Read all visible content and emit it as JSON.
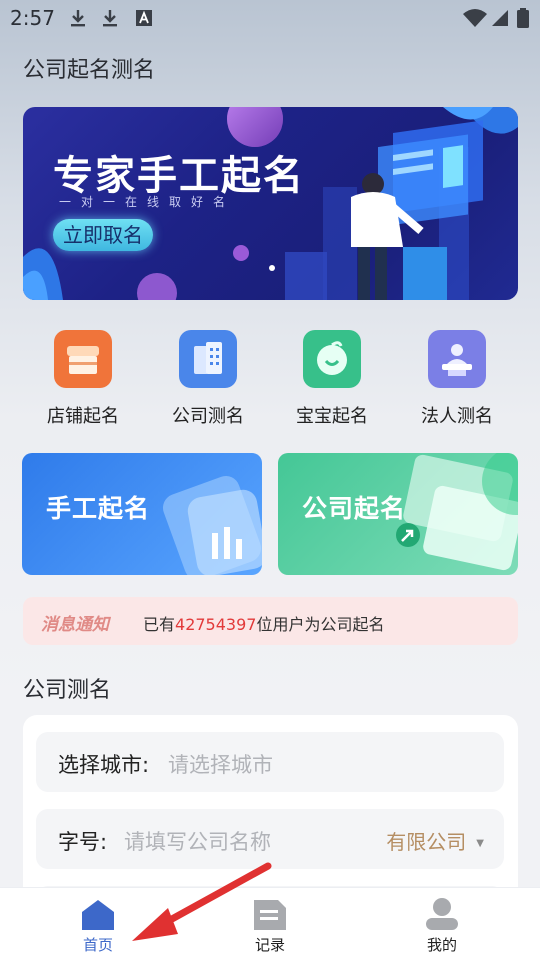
{
  "status_bar": {
    "time": "2:57",
    "left_icons": [
      "download-icon",
      "download-icon",
      "font-a-icon"
    ],
    "right_icons": [
      "wifi-icon",
      "signal-icon",
      "battery-icon"
    ]
  },
  "header": {
    "title": "公司起名测名"
  },
  "banner": {
    "title": "专家手工起名",
    "subtitle": "一对一在线取好名",
    "button_label": "立即取名",
    "page_index": 1
  },
  "categories": [
    {
      "label": "店铺起名",
      "icon": "shop-icon",
      "color": "#f0743a"
    },
    {
      "label": "公司测名",
      "icon": "building-icon",
      "color": "#4a86ea"
    },
    {
      "label": "宝宝起名",
      "icon": "baby-face-icon",
      "color": "#37c08a"
    },
    {
      "label": "法人测名",
      "icon": "person-podium-icon",
      "color": "#7b7fe6"
    }
  ],
  "promos": [
    {
      "label": "手工起名",
      "color": "#3f8cf0"
    },
    {
      "label": "公司起名",
      "color": "#3cc191"
    }
  ],
  "notice": {
    "tag": "消息通知",
    "prefix": "已有",
    "count": "42754397",
    "suffix": "位用户为公司起名"
  },
  "section": {
    "title": "公司测名"
  },
  "form": {
    "city_label": "选择城市:",
    "city_placeholder": "请选择城市",
    "name_label": "字号:",
    "name_placeholder": "请填写公司名称",
    "type_value": "有限公司"
  },
  "bottom_nav": [
    {
      "label": "首页",
      "icon": "home-icon",
      "active": true
    },
    {
      "label": "记录",
      "icon": "document-icon",
      "active": false
    },
    {
      "label": "我的",
      "icon": "user-icon",
      "active": false
    }
  ],
  "colors": {
    "accent": "#3d68c9",
    "notice_count": "#e23a3a",
    "type_select": "#b58e63",
    "annotation_arrow": "#e03131"
  }
}
